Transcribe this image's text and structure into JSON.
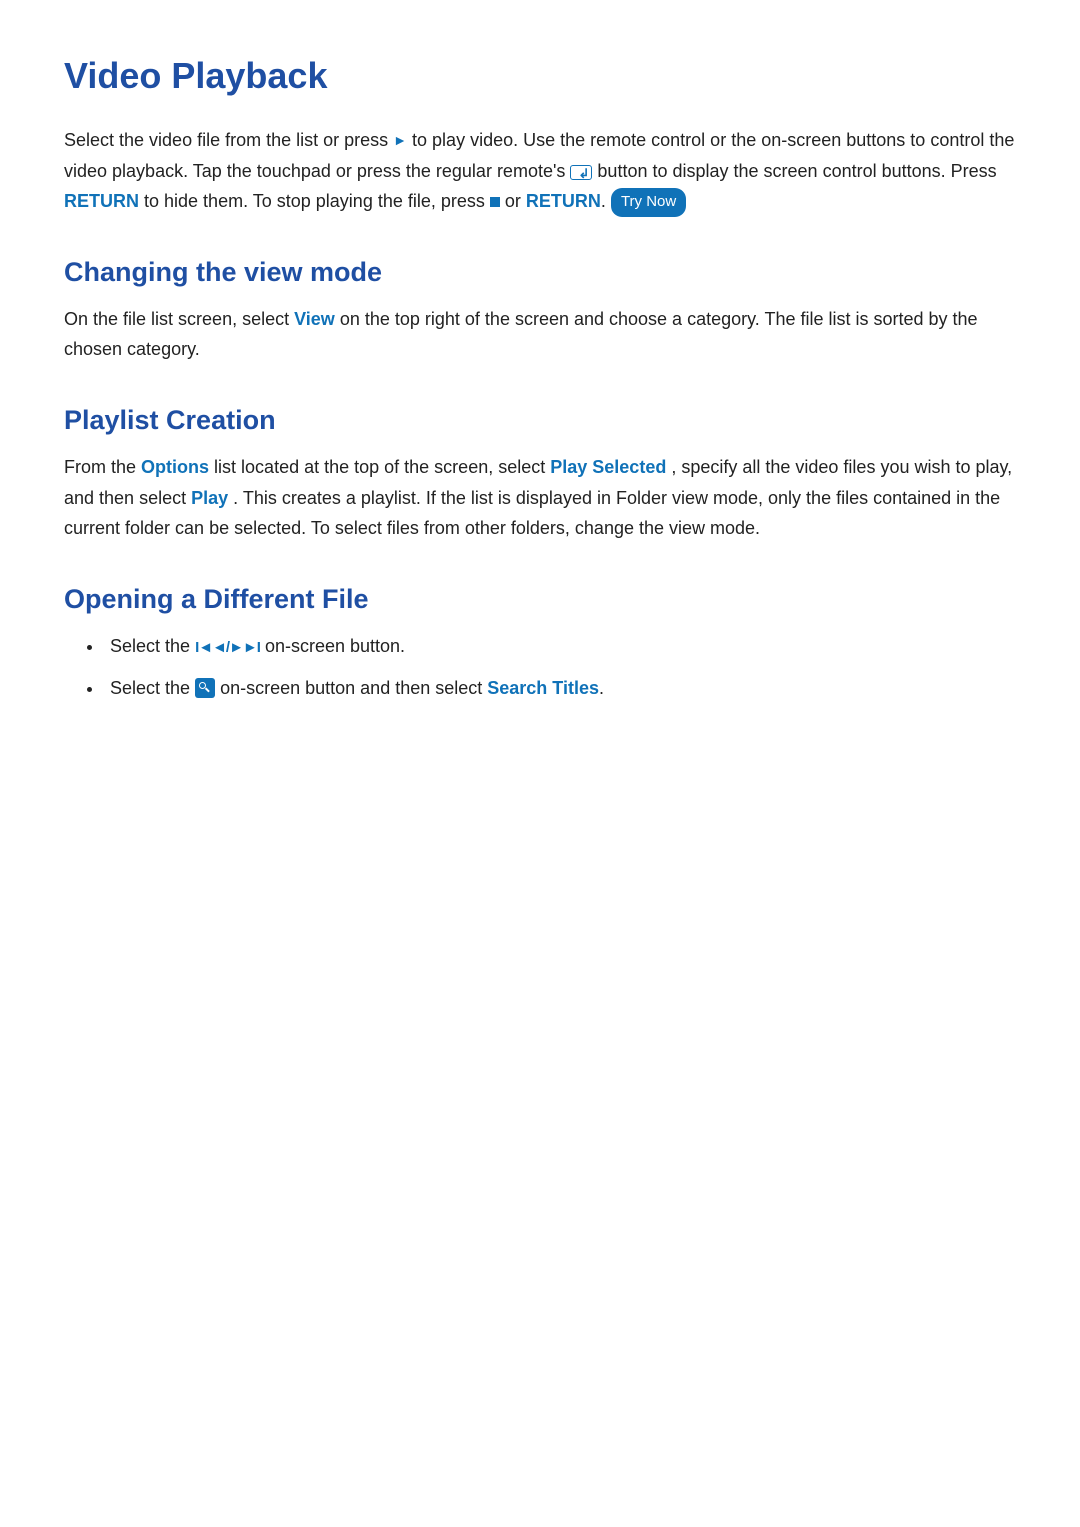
{
  "title": "Video Playback",
  "intro": {
    "t1": "Select the video file from the list or press ",
    "t2": " to play video. Use the remote control or the on-screen buttons to control the video playback. Tap the touchpad or press the regular remote's ",
    "t3": " button to display the screen control buttons. Press ",
    "return1": "RETURN",
    "t4": " to hide them. To stop playing the file, press ",
    "t5": " or ",
    "return2": "RETURN",
    "t6": ". ",
    "try_now": "Try Now"
  },
  "sections": {
    "view_mode": {
      "heading": "Changing the view mode",
      "p_a": "On the file list screen, select ",
      "view": "View",
      "p_b": " on the top right of the screen and choose a category. The file list is sorted by the chosen category."
    },
    "playlist": {
      "heading": "Playlist Creation",
      "p_a": "From the ",
      "options": "Options",
      "p_b": " list located at the top of the screen, select ",
      "play_selected": "Play Selected",
      "p_c": ", specify all the video files you wish to play, and then select ",
      "play": "Play",
      "p_d": ". This creates a playlist. If the list is displayed in Folder view mode, only the files contained in the current folder can be selected. To select files from other folders, change the view mode."
    },
    "open_file": {
      "heading": "Opening a Different File",
      "b1_a": "Select the ",
      "b1_b": " on-screen button.",
      "b2_a": "Select the ",
      "b2_b": " on-screen button and then select ",
      "search_titles": "Search Titles",
      "b2_c": "."
    }
  },
  "icons": {
    "play": "play-icon",
    "enter": "enter-icon",
    "stop": "stop-icon",
    "skip": "skip-prev-next-icon",
    "search": "search-tile-icon"
  }
}
